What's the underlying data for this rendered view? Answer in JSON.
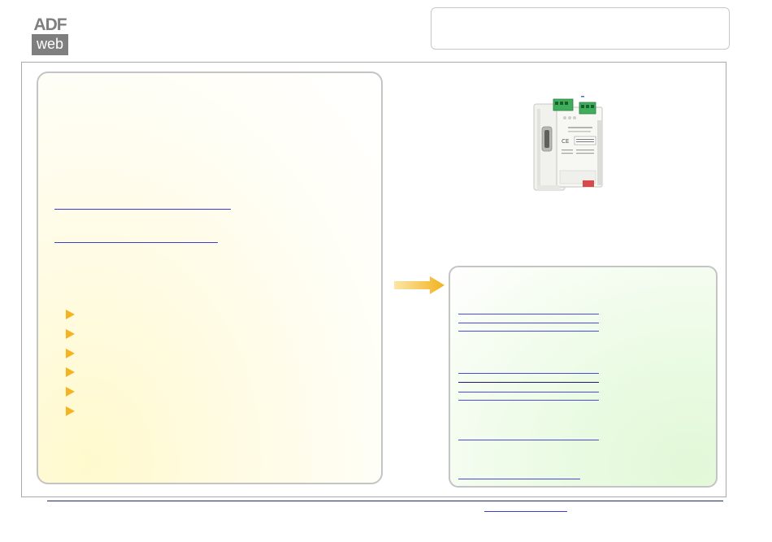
{
  "logo": {
    "top_text": "ADF",
    "bottom_text": "web",
    "background_color": "#7f7f7f"
  },
  "colors": {
    "frame_border": "#a9a9a9",
    "panel_border": "#c4c4c4",
    "left_panel_tint": "#fffacd",
    "right_panel_tint": "#e2f8d8",
    "link_color": "#3b3bd6",
    "bullet_color": "#f5b321",
    "arrow_color": "#f5b321",
    "footer_rule": "#1f2a6b"
  },
  "icons": {
    "bullet": "orange-triangle-bullet-icon",
    "arrow": "orange-right-arrow-icon",
    "product": "din-rail-gateway-device-image"
  }
}
